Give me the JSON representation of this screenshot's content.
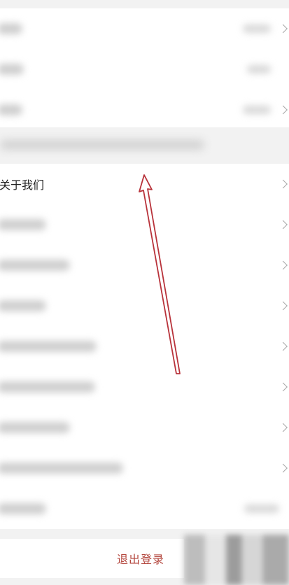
{
  "settings": {
    "top_group_rows": 3,
    "about_us_label": "关于我们",
    "lower_group_rows": 8,
    "logout_label": "退出登录"
  },
  "colors": {
    "page_background": "#f2f2f2",
    "row_background": "#ffffff",
    "logout_text": "#b3453c",
    "annotation_arrow": "#b8323a"
  },
  "icons": {
    "row_chevron": "chevron-right-icon",
    "annotation": "arrow-up-annotation-icon"
  }
}
